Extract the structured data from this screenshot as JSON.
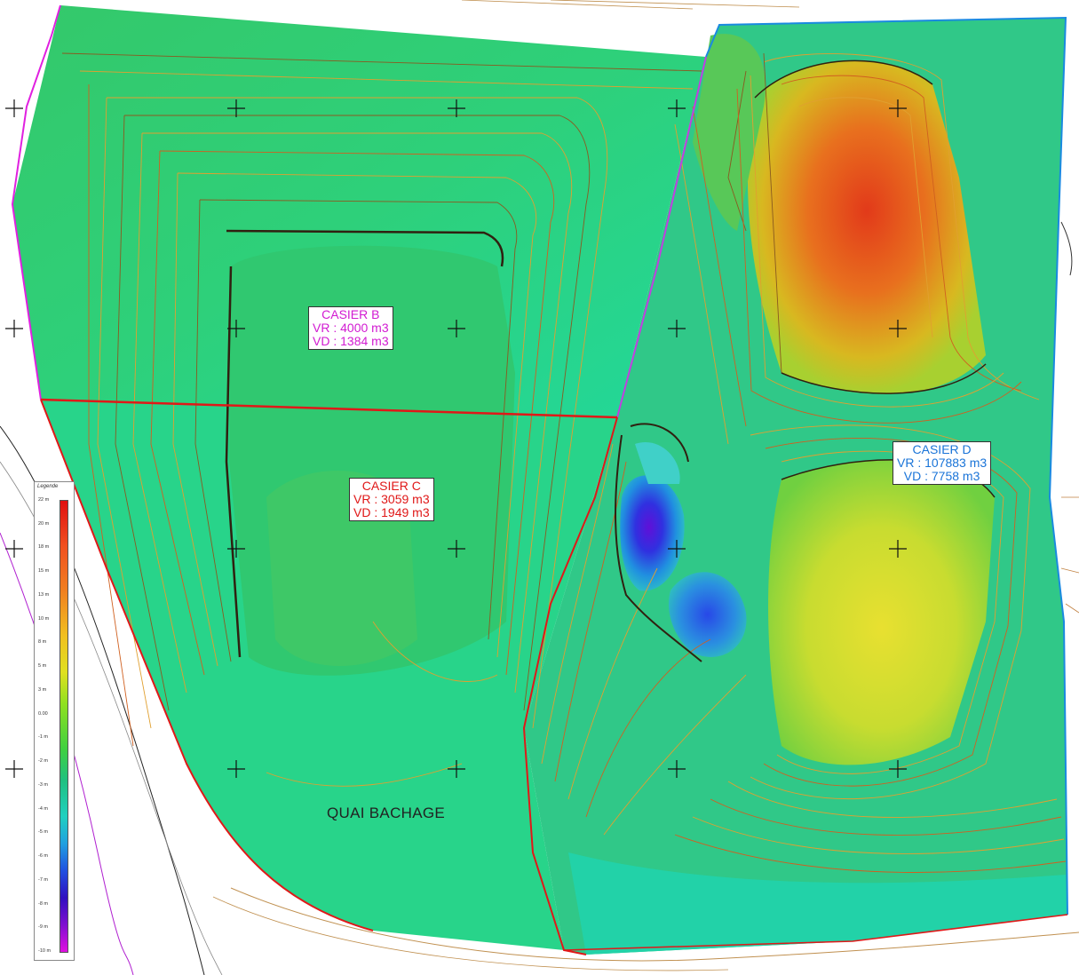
{
  "colors": {
    "casier_b": "#d21bd2",
    "casier_c": "#e01818",
    "casier_d": "#1a74d8",
    "boundary_b": "#e020e0",
    "boundary_c": "#e01818",
    "boundary_d": "#1a8ae0"
  },
  "casiers": {
    "b": {
      "name": "CASIER B",
      "vr": "VR : 4000 m3",
      "vd": "VD : 1384 m3"
    },
    "c": {
      "name": "CASIER C",
      "vr": "VR : 3059 m3",
      "vd": "VD : 1949 m3"
    },
    "d": {
      "name": "CASIER D",
      "vr": "VR : 107883 m3",
      "vd": "VD : 7758 m3"
    }
  },
  "map_text": {
    "quai": "QUAI BACHAGE"
  },
  "legend": {
    "title": "Legende",
    "ticks": [
      "22 m",
      "20 m",
      "18 m",
      "15 m",
      "13 m",
      "10 m",
      "8 m",
      "5 m",
      "3 m",
      "0.00",
      "-1 m",
      "-2 m",
      "-3 m",
      "-4 m",
      "-5 m",
      "-6 m",
      "-7 m",
      "-8 m",
      "-9 m",
      "-10 m"
    ]
  }
}
